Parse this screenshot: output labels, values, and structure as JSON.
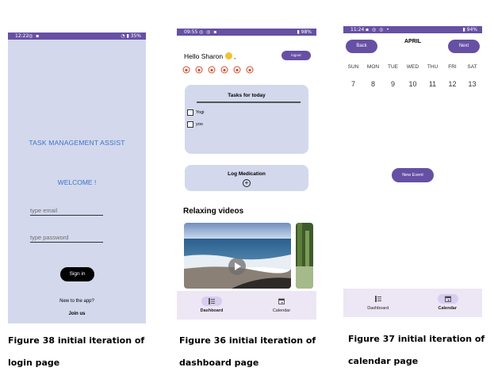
{
  "login": {
    "status": {
      "time": "12:22",
      "battery": "35%"
    },
    "app_title": "TASK MANAGEMENT ASSIST",
    "welcome": "WELCOME !",
    "email_placeholder": "type email",
    "password_placeholder": "type password",
    "signin_label": "Sign in",
    "new_text": "New to the app?",
    "join_label": "Join us"
  },
  "dashboard": {
    "status": {
      "time": "09:55",
      "battery": "98%"
    },
    "greeting": "Hello Sharon",
    "greeting_suffix": ",",
    "logout_label": "logout",
    "tasks_title": "Tasks for today",
    "tasks": [
      "Yogi",
      "yoo"
    ],
    "med_log_title": "Log Medication",
    "relax_title": "Relaxing videos",
    "nav": {
      "dashboard": "Dashboard",
      "calendar": "Calendar"
    }
  },
  "calendar": {
    "status": {
      "time": "11:24",
      "battery": "94%"
    },
    "back_label": "Back",
    "next_label": "Next",
    "month": "APRIL",
    "weekdays": [
      "SUN",
      "MON",
      "TUE",
      "WED",
      "THU",
      "FRI",
      "SAT"
    ],
    "days": [
      "7",
      "8",
      "9",
      "10",
      "11",
      "12",
      "13"
    ],
    "new_event_label": "New Event",
    "nav": {
      "dashboard": "Dashboard",
      "calendar": "Calendar"
    }
  },
  "captions": {
    "fig38_line1": "Figure 38 initial iteration of",
    "fig38_line2": "login page",
    "fig36_line1": "Figure 36 initial iteration of",
    "fig36_line2": "dashboard page",
    "fig37_line1": "Figure 37 initial iteration of",
    "fig37_line2": "calendar page"
  },
  "colors": {
    "accent": "#6650a4",
    "card": "#d3d8ec",
    "nav": "#ede6f5",
    "login_text": "#3b73c9"
  }
}
